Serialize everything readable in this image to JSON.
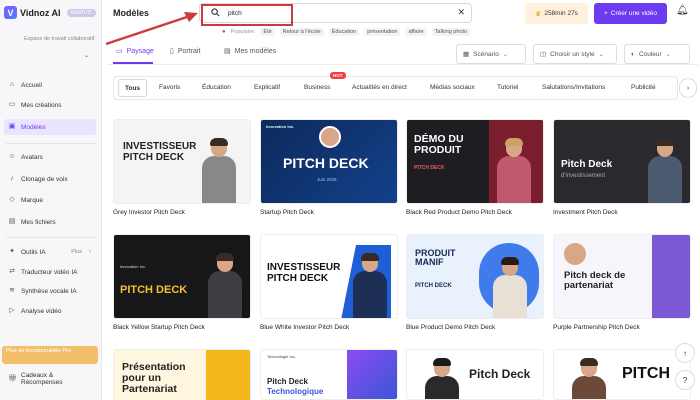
{
  "app": {
    "name": "Vidnoz AI",
    "badge": "GRATUIT"
  },
  "sidebar": {
    "workspace": "Espace de travail collaboratif",
    "items": [
      {
        "label": "Accueil",
        "icon": "home-icon"
      },
      {
        "label": "Mes créations",
        "icon": "folder-icon"
      },
      {
        "label": "Modèles",
        "icon": "template-icon",
        "active": true
      },
      {
        "label": "Avatars",
        "icon": "avatar-icon"
      },
      {
        "label": "Clonage de voix",
        "icon": "voice-icon"
      },
      {
        "label": "Marque",
        "icon": "brand-icon"
      },
      {
        "label": "Mes fichiers",
        "icon": "files-icon"
      },
      {
        "label": "Outils IA",
        "icon": "tools-icon",
        "extra": "Plus"
      },
      {
        "label": "Traducteur vidéo IA",
        "icon": "translate-icon"
      },
      {
        "label": "Synthèse vocale IA",
        "icon": "tts-icon"
      },
      {
        "label": "Analyse vidéo",
        "icon": "analysis-icon"
      },
      {
        "label": "Cadeaux & Récompenses",
        "icon": "gift-icon"
      }
    ],
    "promo": "Plus de fonctionnalités Pro"
  },
  "header": {
    "title": "Modèles",
    "search": {
      "value": "pitch",
      "placeholder": ""
    },
    "popular_label": "Populaire:",
    "popular": [
      "Été",
      "Retour à l'école",
      "Éducation",
      "présentation",
      "affaire",
      "Talking photo"
    ],
    "credits": "258min 27s",
    "create_label": "Créer une vidéo"
  },
  "view_tabs": [
    {
      "label": "Paysage",
      "active": true
    },
    {
      "label": "Portrait"
    },
    {
      "label": "Mes modèles"
    }
  ],
  "filters": {
    "scenario": "Scénario",
    "style": "Choisir un style",
    "color": "Couleur"
  },
  "categories": [
    "Tous",
    "Favoris",
    "Éducation",
    "Explicatif",
    "Business",
    "Actualités en direct",
    "Médias sociaux",
    "Tutoriel",
    "Salutations/Invitations",
    "Publicité"
  ],
  "hot_badge": "HOT",
  "templates": [
    {
      "title": "Grey Investor Pitch Deck",
      "thumb_text": "INVESTISSEUR PITCH DECK"
    },
    {
      "title": "Startup Pitch Deck",
      "thumb_text": "PITCH DECK",
      "thumb_sub": "Juin 2025",
      "thumb_brand": "Innovation Inc."
    },
    {
      "title": "Black Red Product Demo Pitch Deck",
      "thumb_text": "DÉMO DU PRODUIT",
      "thumb_sub": "PITCH DECK"
    },
    {
      "title": "Investment Pitch Deck",
      "thumb_text": "Pitch Deck",
      "thumb_sub": "d'investissement"
    },
    {
      "title": "Black Yellow Startup Pitch Deck",
      "thumb_text": "PITCH DECK",
      "thumb_brand": "Innovation Inc."
    },
    {
      "title": "Blue White Investor Pitch Deck",
      "thumb_text": "INVESTISSEUR PITCH DECK"
    },
    {
      "title": "Blue Product Demo Pitch Deck",
      "thumb_text": "PRODUIT MANIF",
      "thumb_sub": "PITCH DECK"
    },
    {
      "title": "Purple Partnership Pitch Deck",
      "thumb_text": "Pitch deck de partenariat"
    },
    {
      "title": "",
      "thumb_text": "Présentation pour un Partenariat"
    },
    {
      "title": "",
      "thumb_text": "Pitch Deck",
      "thumb_sub": "Technologique",
      "thumb_brand": "Technologie Inc."
    },
    {
      "title": "",
      "thumb_text": "Pitch Deck"
    },
    {
      "title": "",
      "thumb_text": "PITCH"
    }
  ],
  "colors": {
    "accent": "#6d3cf0",
    "highlight": "#d0393c"
  }
}
